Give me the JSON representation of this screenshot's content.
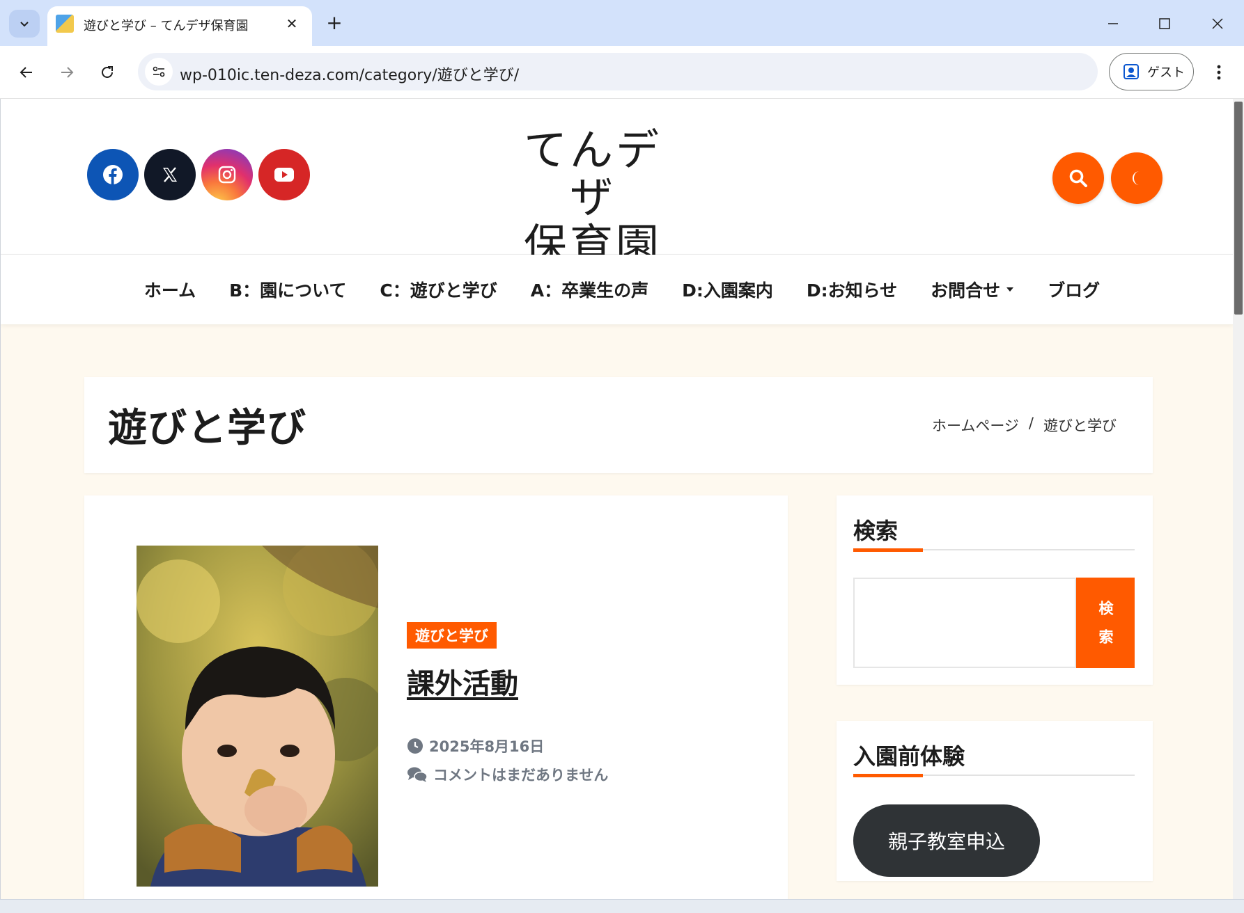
{
  "browser": {
    "tab_title": "遊びと学び – てんデザ保育園",
    "url": "wp-010ic.ten-deza.com/category/遊びと学び/",
    "profile_label": "ゲスト"
  },
  "site": {
    "logo_line1": "てんデザ",
    "logo_line2": "保育園",
    "social": [
      {
        "icon": "facebook-icon",
        "color": "#0d55b5"
      },
      {
        "icon": "x-icon",
        "color": "#111827"
      },
      {
        "icon": "instagram-icon",
        "color": "#e1306c"
      },
      {
        "icon": "youtube-icon",
        "color": "#d62626"
      }
    ],
    "accent": "#ff5a00"
  },
  "nav": {
    "items": [
      "ホーム",
      "B：園について",
      "C：遊びと学び",
      "A：卒業生の声",
      "D:入園案内",
      "D:お知らせ",
      "お問合せ",
      "ブログ"
    ]
  },
  "page": {
    "title": "遊びと学び",
    "breadcrumb_home": "ホームページ",
    "breadcrumb_sep": "/",
    "breadcrumb_current": "遊びと学び"
  },
  "post": {
    "category": "遊びと学び",
    "title": "課外活動",
    "date": "2025年8月16日",
    "comments": "コメントはまだありません"
  },
  "sidebar": {
    "search_title": "検索",
    "search_button": "検索",
    "widget2_title": "入園前体験",
    "widget2_button": "親子教室申込"
  }
}
